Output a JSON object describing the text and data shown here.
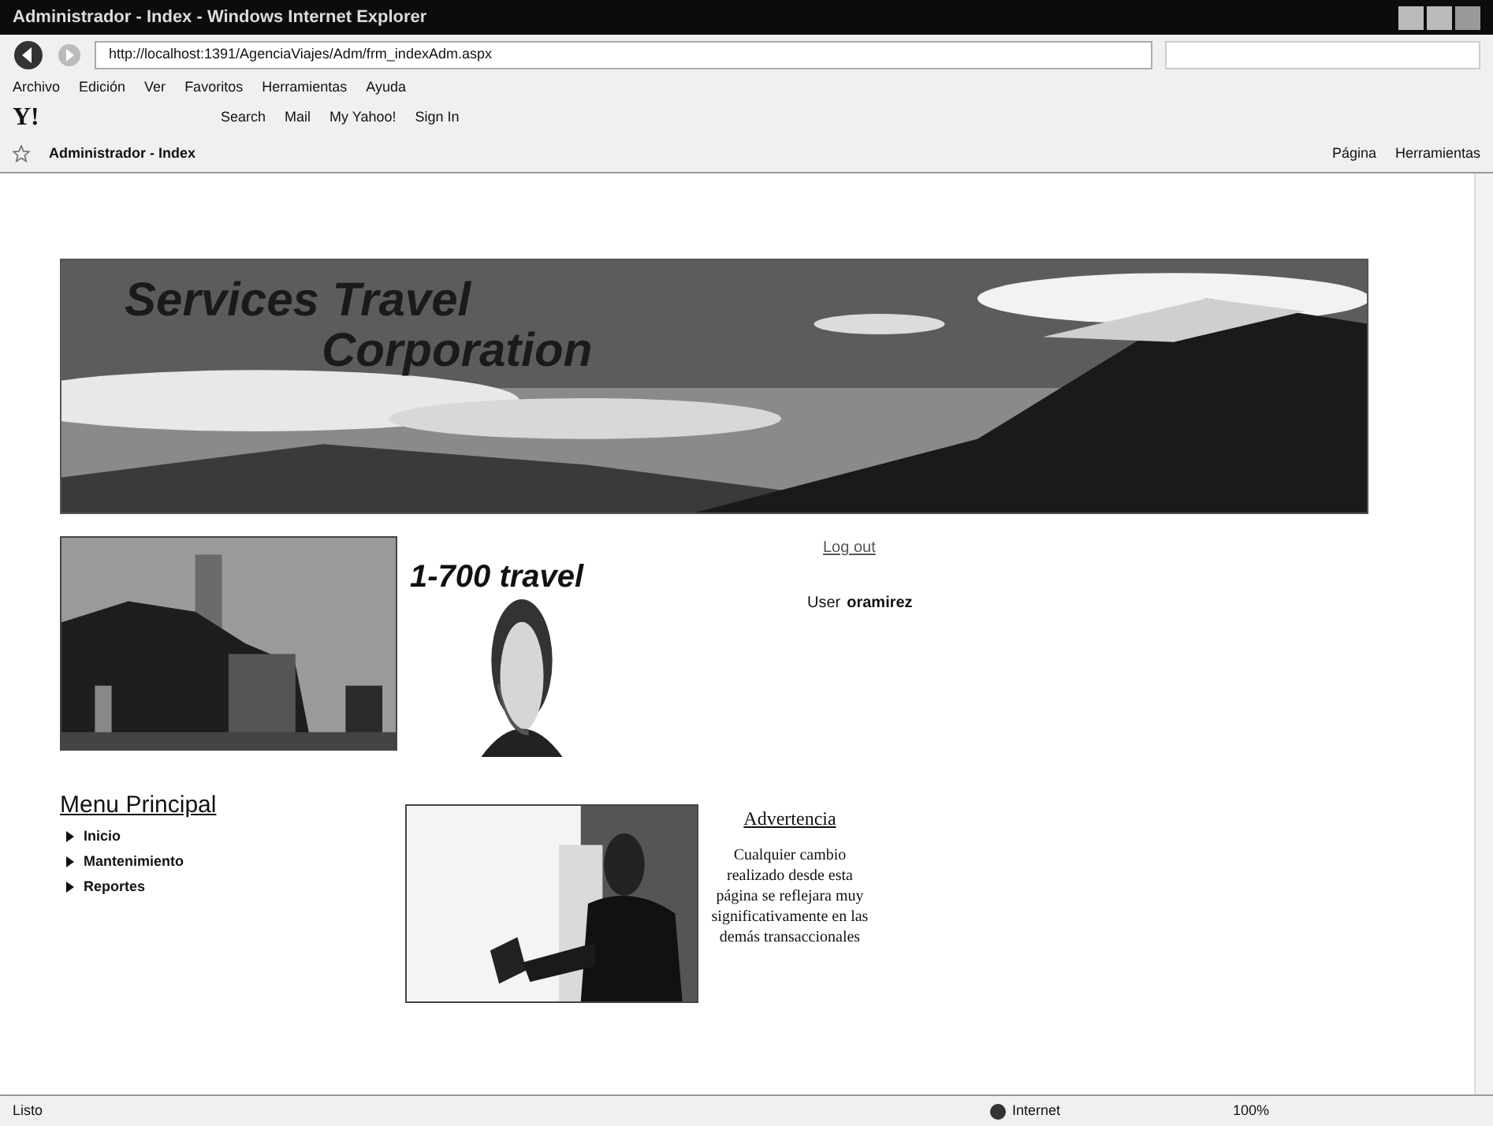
{
  "window": {
    "title": "Administrador - Index - Windows Internet Explorer"
  },
  "address_bar": {
    "url": "http://localhost:1391/AgenciaViajes/Adm/frm_indexAdm.aspx"
  },
  "menu_bar": [
    "Archivo",
    "Edición",
    "Ver",
    "Favoritos",
    "Herramientas",
    "Ayuda"
  ],
  "yahoo_toolbar": {
    "logo": "Y!",
    "items": [
      "Search",
      "Mail",
      "My Yahoo!",
      "Sign In"
    ]
  },
  "tab": {
    "label": "Administrador - Index"
  },
  "command_bar": [
    "Página",
    "Herramientas"
  ],
  "page": {
    "banner_title_1": "Services Travel",
    "banner_title_2": "Corporation",
    "brand": "1-700 travel",
    "logout": "Log out",
    "user_label": "User",
    "user_name": "oramirez",
    "menu_title": "Menu Principal",
    "menu_items": [
      {
        "label": "Inicio"
      },
      {
        "label": "Mantenimiento"
      },
      {
        "label": "Reportes"
      }
    ],
    "warning_title": "Advertencia",
    "warning_text": "Cualquier cambio realizado desde esta página se reflejara muy significativamente en las demás transaccionales"
  },
  "status_bar": {
    "text": "Listo",
    "zone": "Internet",
    "zoom": "100%"
  }
}
